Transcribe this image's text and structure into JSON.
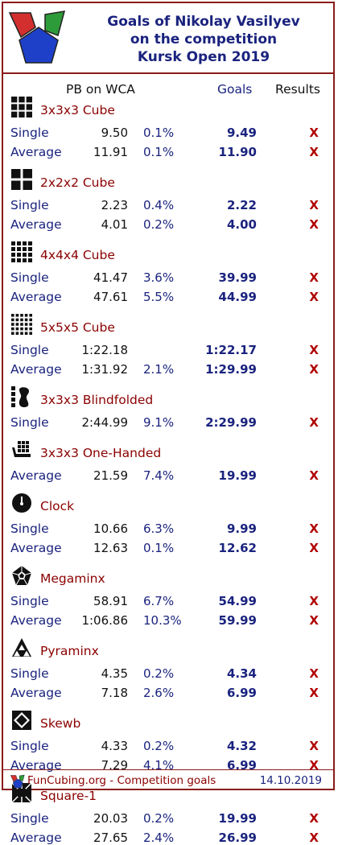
{
  "title_lines": [
    "Goals of Nikolay Vasilyev",
    "on the competition",
    "Kursk Open 2019"
  ],
  "columns": {
    "pb": "PB on WCA",
    "goals": "Goals",
    "results": "Results"
  },
  "events": [
    {
      "name": "3x3x3 Cube",
      "icon": "cube-3x3-icon",
      "rows": [
        {
          "type": "Single",
          "pb": "9.50",
          "pct": "0.1%",
          "goal": "9.49",
          "result": "X"
        },
        {
          "type": "Average",
          "pb": "11.91",
          "pct": "0.1%",
          "goal": "11.90",
          "result": "X"
        }
      ]
    },
    {
      "name": "2x2x2 Cube",
      "icon": "cube-2x2-icon",
      "rows": [
        {
          "type": "Single",
          "pb": "2.23",
          "pct": "0.4%",
          "goal": "2.22",
          "result": "X"
        },
        {
          "type": "Average",
          "pb": "4.01",
          "pct": "0.2%",
          "goal": "4.00",
          "result": "X"
        }
      ]
    },
    {
      "name": "4x4x4 Cube",
      "icon": "cube-4x4-icon",
      "rows": [
        {
          "type": "Single",
          "pb": "41.47",
          "pct": "3.6%",
          "goal": "39.99",
          "result": "X"
        },
        {
          "type": "Average",
          "pb": "47.61",
          "pct": "5.5%",
          "goal": "44.99",
          "result": "X"
        }
      ]
    },
    {
      "name": "5x5x5 Cube",
      "icon": "cube-5x5-icon",
      "rows": [
        {
          "type": "Single",
          "pb": "1:22.18",
          "pct": "",
          "goal": "1:22.17",
          "result": "X"
        },
        {
          "type": "Average",
          "pb": "1:31.92",
          "pct": "2.1%",
          "goal": "1:29.99",
          "result": "X"
        }
      ]
    },
    {
      "name": "3x3x3 Blindfolded",
      "icon": "blindfolded-icon",
      "rows": [
        {
          "type": "Single",
          "pb": "2:44.99",
          "pct": "9.1%",
          "goal": "2:29.99",
          "result": "X"
        }
      ]
    },
    {
      "name": "3x3x3 One-Handed",
      "icon": "one-handed-icon",
      "rows": [
        {
          "type": "Average",
          "pb": "21.59",
          "pct": "7.4%",
          "goal": "19.99",
          "result": "X"
        }
      ]
    },
    {
      "name": "Clock",
      "icon": "clock-icon",
      "rows": [
        {
          "type": "Single",
          "pb": "10.66",
          "pct": "6.3%",
          "goal": "9.99",
          "result": "X"
        },
        {
          "type": "Average",
          "pb": "12.63",
          "pct": "0.1%",
          "goal": "12.62",
          "result": "X"
        }
      ]
    },
    {
      "name": "Megaminx",
      "icon": "megaminx-icon",
      "rows": [
        {
          "type": "Single",
          "pb": "58.91",
          "pct": "6.7%",
          "goal": "54.99",
          "result": "X"
        },
        {
          "type": "Average",
          "pb": "1:06.86",
          "pct": "10.3%",
          "goal": "59.99",
          "result": "X"
        }
      ]
    },
    {
      "name": "Pyraminx",
      "icon": "pyraminx-icon",
      "rows": [
        {
          "type": "Single",
          "pb": "4.35",
          "pct": "0.2%",
          "goal": "4.34",
          "result": "X"
        },
        {
          "type": "Average",
          "pb": "7.18",
          "pct": "2.6%",
          "goal": "6.99",
          "result": "X"
        }
      ]
    },
    {
      "name": "Skewb",
      "icon": "skewb-icon",
      "rows": [
        {
          "type": "Single",
          "pb": "4.33",
          "pct": "0.2%",
          "goal": "4.32",
          "result": "X"
        },
        {
          "type": "Average",
          "pb": "7.29",
          "pct": "4.1%",
          "goal": "6.99",
          "result": "X"
        }
      ]
    },
    {
      "name": "Square-1",
      "icon": "square-1-icon",
      "rows": [
        {
          "type": "Single",
          "pb": "20.03",
          "pct": "0.2%",
          "goal": "19.99",
          "result": "X"
        },
        {
          "type": "Average",
          "pb": "27.65",
          "pct": "2.4%",
          "goal": "26.99",
          "result": "X"
        }
      ]
    }
  ],
  "footer": {
    "site": "FunCubing.org - Competition goals",
    "date": "14.10.2019"
  },
  "colors": {
    "border": "#8b1a1a",
    "title": "#1a237e",
    "event_name": "#8b0000",
    "result_x": "#b00000"
  }
}
